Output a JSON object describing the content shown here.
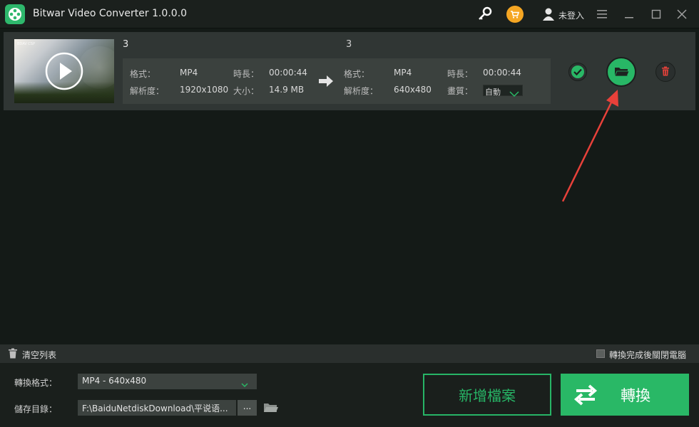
{
  "app": {
    "title": "Bitwar Video Converter  1.0.0.0",
    "user_label": "未登入"
  },
  "task": {
    "source_name": "3",
    "target_name": "3",
    "thumbnail_tag": "BDAV CSP",
    "source": {
      "format_label": "格式：",
      "format_value": "MP4",
      "duration_label": "時長：",
      "duration_value": "00:00:44",
      "resolution_label": "解析度：",
      "resolution_value": "1920x1080",
      "size_label": "大小：",
      "size_value": "14.9 MB"
    },
    "target": {
      "format_label": "格式：",
      "format_value": "MP4",
      "duration_label": "時長：",
      "duration_value": "00:00:44",
      "resolution_label": "解析度：",
      "resolution_value": "640x480",
      "quality_label": "畫質：",
      "quality_value": "自動"
    }
  },
  "footer": {
    "clear_list_label": "清空列表",
    "shutdown_label": "轉換完成後關閉電腦"
  },
  "bottom": {
    "format_label": "轉換格式：",
    "format_value": "MP4 - 640x480",
    "save_dir_label": "儲存目錄：",
    "save_dir_value": "F:\\BaiduNetdiskDownload\\平说语...",
    "browse_label": "...",
    "add_file_label": "新增檔案",
    "convert_label": "轉換"
  },
  "colors": {
    "accent": "#29b866",
    "background": "#141a17",
    "annotation": "#e8413a",
    "cart": "#f5a623"
  }
}
